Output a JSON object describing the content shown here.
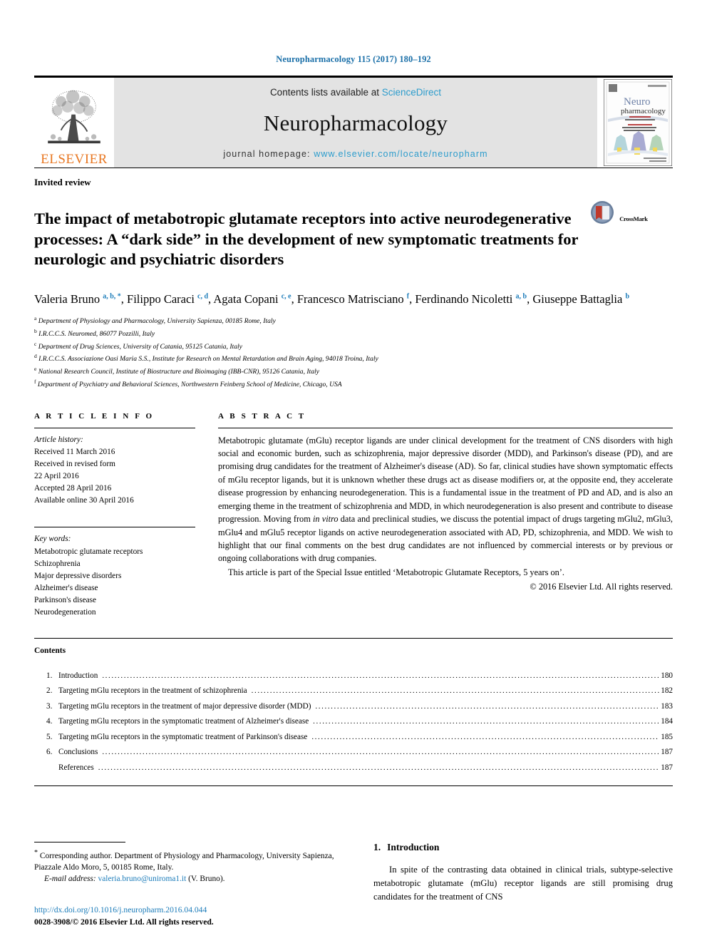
{
  "running_head": "Neuropharmacology 115 (2017) 180–192",
  "masthead": {
    "publisher": "ELSEVIER",
    "contents_prefix": "Contents lists available at ",
    "contents_link": "ScienceDirect",
    "journal_name": "Neuropharmacology",
    "homepage_prefix": "journal homepage: ",
    "homepage_link": "www.elsevier.com/locate/neuropharm",
    "cover": {
      "line1": "Neuro",
      "line2": "pharmacology"
    }
  },
  "article": {
    "doctype": "Invited review",
    "title": "The impact of metabotropic glutamate receptors into active neurodegenerative processes: A “dark side” in the development of new symptomatic treatments for neurologic and psychiatric disorders",
    "crossmark_label": "CrossMark",
    "authors": [
      {
        "name": "Valeria Bruno",
        "marks": "a, b, *",
        "sep": ", "
      },
      {
        "name": "Filippo Caraci",
        "marks": "c, d",
        "sep": ", "
      },
      {
        "name": "Agata Copani",
        "marks": "c, e",
        "sep": ", "
      },
      {
        "name": "Francesco Matrisciano",
        "marks": "f",
        "sep": ", "
      },
      {
        "name": "Ferdinando Nicoletti",
        "marks": "a, b",
        "sep": ", "
      },
      {
        "name": "Giuseppe Battaglia",
        "marks": "b",
        "sep": ""
      }
    ],
    "affiliations": [
      {
        "mark": "a",
        "text": "Department of Physiology and Pharmacology, University Sapienza, 00185 Rome, Italy"
      },
      {
        "mark": "b",
        "text": "I.R.C.C.S. Neuromed, 86077 Pozzilli, Italy"
      },
      {
        "mark": "c",
        "text": "Department of Drug Sciences, University of Catania, 95125 Catania, Italy"
      },
      {
        "mark": "d",
        "text": "I.R.C.C.S. Associazione Oasi Maria S.S., Institute for Research on Mental Retardation and Brain Aging, 94018 Troina, Italy"
      },
      {
        "mark": "e",
        "text": "National Research Council, Institute of Biostructure and Bioimaging (IBB-CNR), 95126 Catania, Italy"
      },
      {
        "mark": "f",
        "text": "Department of Psychiatry and Behavioral Sciences, Northwestern Feinberg School of Medicine, Chicago, USA"
      }
    ]
  },
  "article_info": {
    "heading": "A R T I C L E  I N F O",
    "history_title": "Article history:",
    "history": [
      "Received 11 March 2016",
      "Received in revised form",
      "22 April 2016",
      "Accepted 28 April 2016",
      "Available online 30 April 2016"
    ],
    "keywords_title": "Key words:",
    "keywords": [
      "Metabotropic glutamate receptors",
      "Schizophrenia",
      "Major depressive disorders",
      "Alzheimer's disease",
      "Parkinson's disease",
      "Neurodegeneration"
    ]
  },
  "abstract": {
    "heading": "A B S T R A C T",
    "paragraph1_a": "Metabotropic glutamate (mGlu) receptor ligands are under clinical development for the treatment of CNS disorders with high social and economic burden, such as schizophrenia, major depressive disorder (MDD), and Parkinson's disease (PD), and are promising drug candidates for the treatment of Alzheimer's disease (AD). So far, clinical studies have shown symptomatic effects of mGlu receptor ligands, but it is unknown whether these drugs act as disease modifiers or, at the opposite end, they accelerate disease progression by enhancing neurodegeneration. This is a fundamental issue in the treatment of PD and AD, and is also an emerging theme in the treatment of schizophrenia and MDD, in which neurodegeneration is also present and contribute to disease progression. Moving from ",
    "paragraph1_italic": "in vitro",
    "paragraph1_b": " data and preclinical studies, we discuss the potential impact of drugs targeting mGlu2, mGlu3, mGlu4 and mGlu5 receptor ligands on active neurodegeneration associated with AD, PD, schizophrenia, and MDD. We wish to highlight that our final comments on the best drug candidates are not influenced by commercial interests or by previous or ongoing collaborations with drug companies.",
    "paragraph2": "This article is part of the Special Issue entitled ‘Metabotropic Glutamate Receptors, 5 years on’.",
    "copyright": "© 2016 Elsevier Ltd. All rights reserved."
  },
  "contents": {
    "title": "Contents",
    "items": [
      {
        "num": "1.",
        "label": "Introduction",
        "page": "180"
      },
      {
        "num": "2.",
        "label": "Targeting mGlu receptors in the treatment of schizophrenia",
        "page": "182"
      },
      {
        "num": "3.",
        "label": "Targeting mGlu receptors in the treatment of major depressive disorder (MDD)",
        "page": "183"
      },
      {
        "num": "4.",
        "label": "Targeting mGlu receptors in the symptomatic treatment of Alzheimer's disease",
        "page": "184"
      },
      {
        "num": "5.",
        "label": "Targeting mGlu receptors in the symptomatic treatment of Parkinson's disease",
        "page": "185"
      },
      {
        "num": "6.",
        "label": "Conclusions",
        "page": "187"
      },
      {
        "num": "",
        "label": "References",
        "page": "187"
      }
    ],
    "leader": "..............................................................................................................................................................................................."
  },
  "footer": {
    "corresponding_star": "*",
    "corresponding_text": " Corresponding author. Department of Physiology and Pharmacology, University Sapienza, Piazzale Aldo Moro, 5, 00185 Rome, Italy.",
    "email_label": "E-mail address:",
    "email": "valeria.bruno@uniroma1.it",
    "email_suffix": " (V. Bruno).",
    "doi": "http://dx.doi.org/10.1016/j.neuropharm.2016.04.044",
    "issn_line": "0028-3908/© 2016 Elsevier Ltd. All rights reserved."
  },
  "introduction": {
    "number": "1.",
    "title": "Introduction",
    "paragraph": "In spite of the contrasting data obtained in clinical trials, subtype-selective metabotropic glutamate (mGlu) receptor ligands are still promising drug candidates for the treatment of CNS"
  },
  "colors": {
    "link_blue": "#1a7bb9",
    "sciencedirect_blue": "#2c9ccc",
    "elsevier_orange": "#E87722",
    "masthead_gray": "#e3e3e3"
  }
}
